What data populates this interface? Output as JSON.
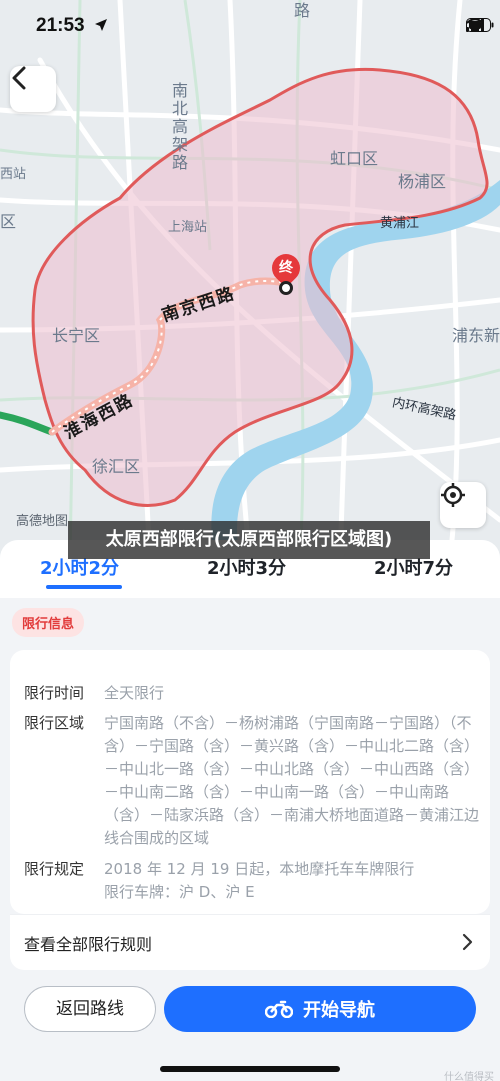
{
  "status_bar": {
    "time": "21:53"
  },
  "map": {
    "labels": {
      "nanbei_gaojia": "南北高架路",
      "hongkou": "虹口区",
      "yangpu": "杨浦区",
      "huangpujiang": "黄浦江",
      "shanghai_station": "上海站",
      "changning": "长宁区",
      "pudong": "浦东新",
      "neihuan_gaojia": "内环高架路",
      "xuhui": "徐汇区",
      "west_station": "西站",
      "qu_left": "区",
      "top_road": "路"
    },
    "route_roads": {
      "nanjing_xilu": "南京西路",
      "huaihai_xilu": "淮海西路"
    },
    "end_marker": "终",
    "logo": "高德地图"
  },
  "overlay_caption": "太原西部限行(太原西部限行区域图)",
  "tabs": [
    {
      "label": "2小时2分",
      "active": true
    },
    {
      "label": "2小时3分",
      "active": false
    },
    {
      "label": "2小时7分",
      "active": false
    }
  ],
  "restriction": {
    "badge": "限行信息",
    "time_label": "限行时间",
    "time_value": "全天限行",
    "area_label": "限行区域",
    "area_value": "宁国南路（不含）－杨树浦路（宁国南路－宁国路）（不含）－宁国路（含）－黄兴路（含）－中山北二路（含）－中山北一路（含）－中山北路（含）－中山西路（含）－中山南二路（含）－中山南一路（含）－中山南路（含）－陆家浜路（含）－南浦大桥地面道路－黄浦江边线合围成的区域",
    "rule_label": "限行规定",
    "rule_value": "2018 年 12 月 19 日起，本地摩托车车牌限行\n限行车牌：沪 D、沪 E",
    "all_rules": "查看全部限行规则"
  },
  "buttons": {
    "return_route": "返回路线",
    "start_nav": "开始导航"
  },
  "watermark": "什么值得买",
  "colors": {
    "accent": "#1e6fff",
    "restriction_red": "#e23b3b",
    "zone_fill": "#f3dde3"
  }
}
